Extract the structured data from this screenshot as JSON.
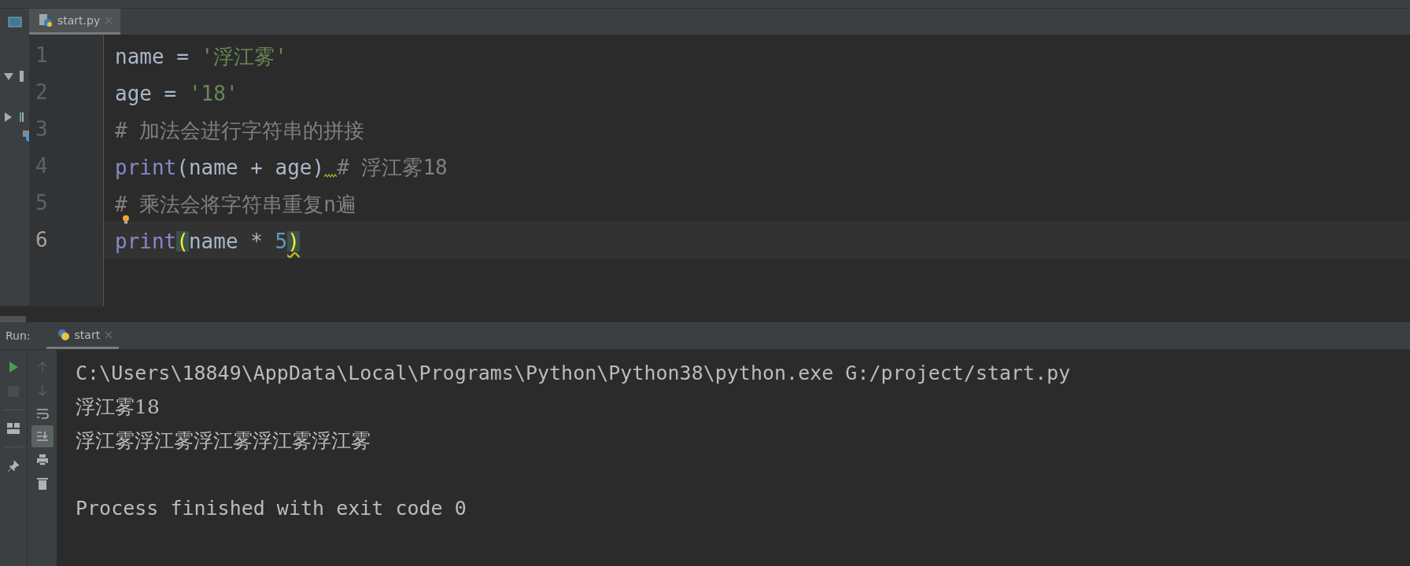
{
  "editor_tabs": [
    {
      "label": "start.py",
      "selected": true
    }
  ],
  "code_lines": [
    {
      "number": "1",
      "current": false,
      "tokens": [
        {
          "text": "name = ",
          "kind": "plain"
        },
        {
          "text": "'浮江雾'",
          "kind": "string"
        }
      ]
    },
    {
      "number": "2",
      "current": false,
      "tokens": [
        {
          "text": "age = ",
          "kind": "plain"
        },
        {
          "text": "'18'",
          "kind": "string"
        }
      ]
    },
    {
      "number": "3",
      "current": false,
      "tokens": [
        {
          "text": "# 加法会进行字符串的拼接",
          "kind": "comment"
        }
      ]
    },
    {
      "number": "4",
      "current": false,
      "tokens": [
        {
          "text": "print",
          "kind": "builtin"
        },
        {
          "text": "(name + age)",
          "kind": "plain",
          "squiggle_after": true
        },
        {
          "text": "# 浮江雾18",
          "kind": "comment"
        }
      ]
    },
    {
      "number": "5",
      "current": false,
      "hint": true,
      "tokens": [
        {
          "text": "# 乘法会将字符串重复n遍",
          "kind": "comment"
        }
      ]
    },
    {
      "number": "6",
      "current": true,
      "tokens": [
        {
          "text": "print",
          "kind": "builtin"
        },
        {
          "text": "(",
          "kind": "brace"
        },
        {
          "text": "name * ",
          "kind": "plain"
        },
        {
          "text": "5",
          "kind": "number"
        },
        {
          "text": ")",
          "kind": "brace",
          "squiggle": true
        }
      ]
    }
  ],
  "run_panel": {
    "label": "Run:",
    "tabs": [
      {
        "label": "start",
        "selected": true
      }
    ],
    "output": [
      {
        "text": "C:\\Users\\18849\\AppData\\Local\\Programs\\Python\\Python38\\python.exe G:/project/start.py",
        "kind": "command"
      },
      {
        "text": "浮江雾18",
        "kind": "stdout"
      },
      {
        "text": "浮江雾浮江雾浮江雾浮江雾浮江雾",
        "kind": "stdout"
      },
      {
        "text": "Process finished with exit code 0",
        "kind": "status"
      }
    ]
  }
}
